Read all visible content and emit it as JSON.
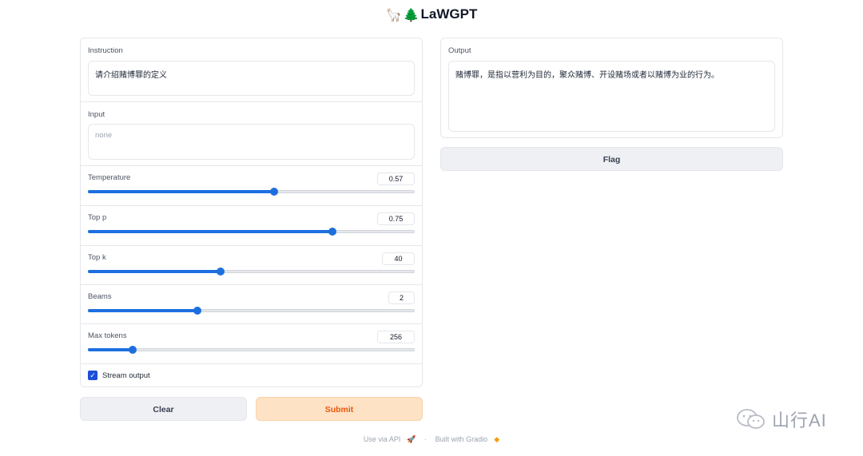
{
  "app": {
    "title": "LaWGPT",
    "emoji_llama": "🦙",
    "emoji_tree": "🌲"
  },
  "instruction": {
    "label": "Instruction",
    "value": "请介绍赌博罪的定义"
  },
  "input": {
    "label": "Input",
    "placeholder": "none"
  },
  "sliders": [
    {
      "label": "Temperature",
      "value": "0.57",
      "fraction": 0.57
    },
    {
      "label": "Top p",
      "value": "0.75",
      "fraction": 0.75
    },
    {
      "label": "Top k",
      "value": "40",
      "fraction": 0.405
    },
    {
      "label": "Beams",
      "value": "2",
      "fraction": 0.335
    },
    {
      "label": "Max tokens",
      "value": "256",
      "fraction": 0.135
    }
  ],
  "stream_output": {
    "label": "Stream output",
    "checked": true
  },
  "buttons": {
    "clear": "Clear",
    "submit": "Submit",
    "flag": "Flag"
  },
  "output": {
    "label": "Output",
    "value": "赌博罪，是指以营利为目的，聚众赌博、开设赌场或者以赌博为业的行为。"
  },
  "footer": {
    "api": "Use via API",
    "separator": "·",
    "built": "Built with Gradio"
  },
  "watermark": {
    "text": "山行AI"
  },
  "colors": {
    "accent": "#1d6fe0",
    "submit_bg": "#fde2c5",
    "submit_text": "#ea580c"
  }
}
